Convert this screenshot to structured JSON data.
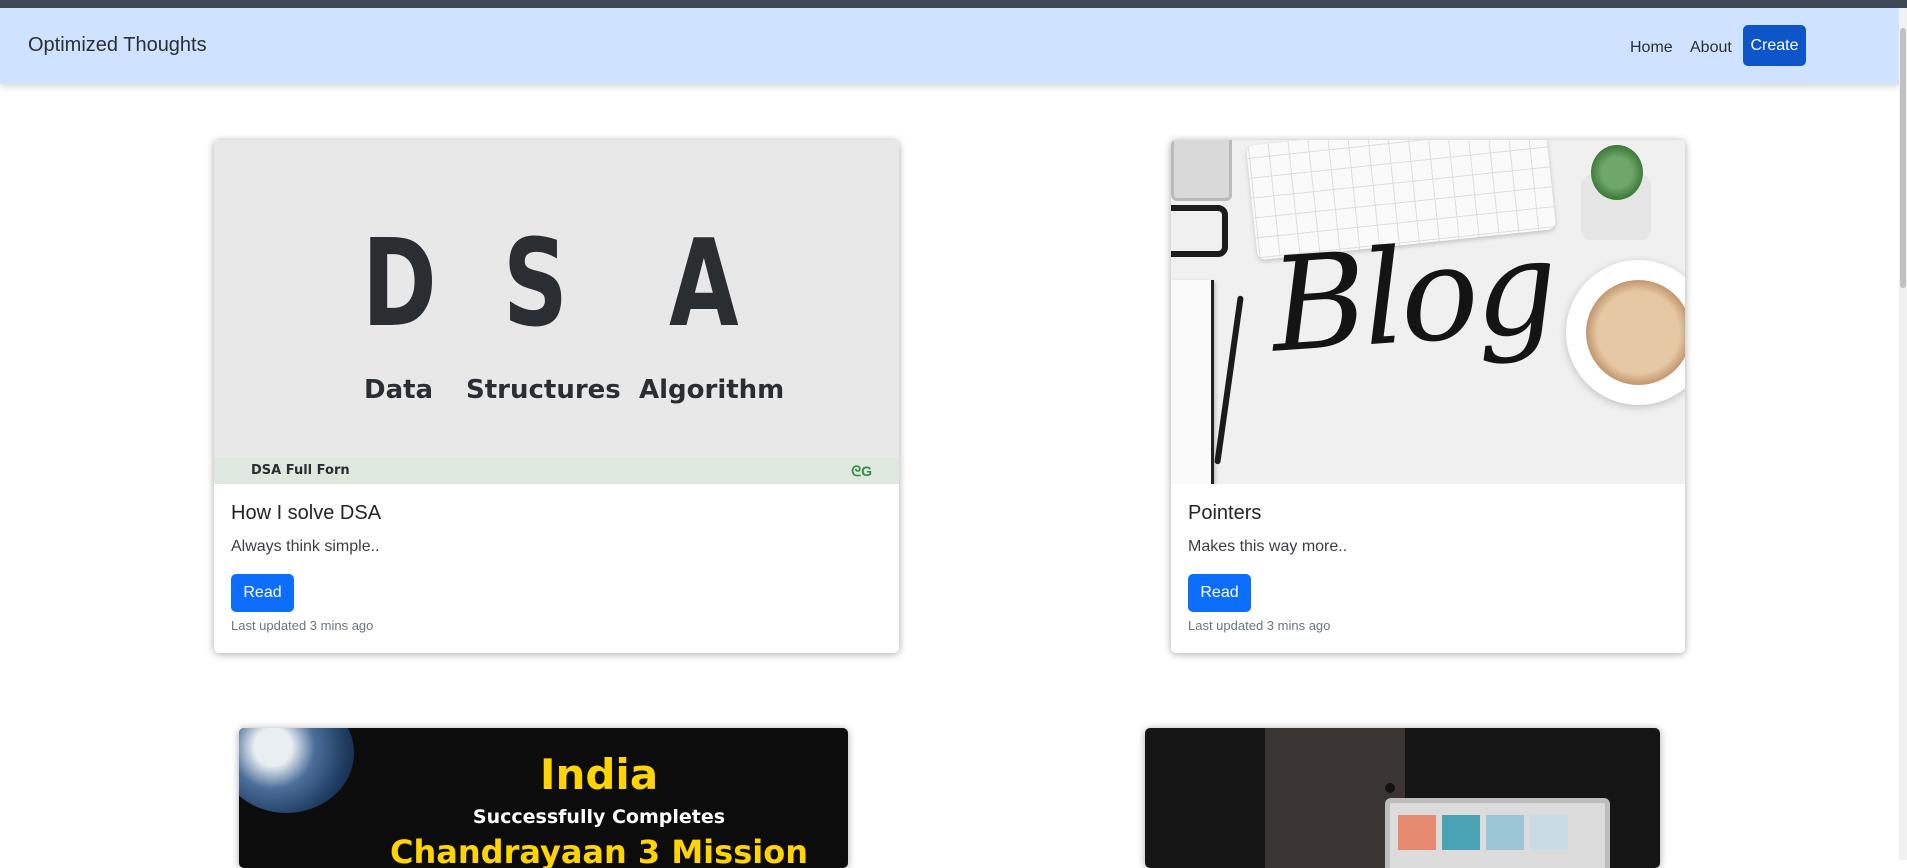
{
  "navbar": {
    "brand": "Optimized Thoughts",
    "links": [
      {
        "label": "Home"
      },
      {
        "label": "About"
      }
    ],
    "create_label": "Create"
  },
  "posts": [
    {
      "title": "How I solve DSA",
      "excerpt": "Always think simple..",
      "read_label": "Read",
      "updated": "Last updated 3 mins ago",
      "image": {
        "letters": [
          "D",
          "S",
          "A"
        ],
        "words": [
          "Data",
          "Structures",
          "Algorithm"
        ],
        "footer": "DSA Full Forn",
        "logo": "gfg-logo-icon"
      }
    },
    {
      "title": "Pointers",
      "excerpt": "Makes this way more..",
      "read_label": "Read",
      "updated": "Last updated 3 mins ago",
      "image": {
        "text": "Blog"
      }
    },
    {
      "image": {
        "line1": "India",
        "line2": "Successfully Completes",
        "line3": "Chandrayaan 3 Mission"
      }
    },
    {
      "image": {
        "description_icon": "laptop-photo-icon"
      }
    }
  ],
  "colors": {
    "navbar_bg": "#cfe2ff",
    "primary": "#0d6efd",
    "create_button": "#0d55c9"
  }
}
